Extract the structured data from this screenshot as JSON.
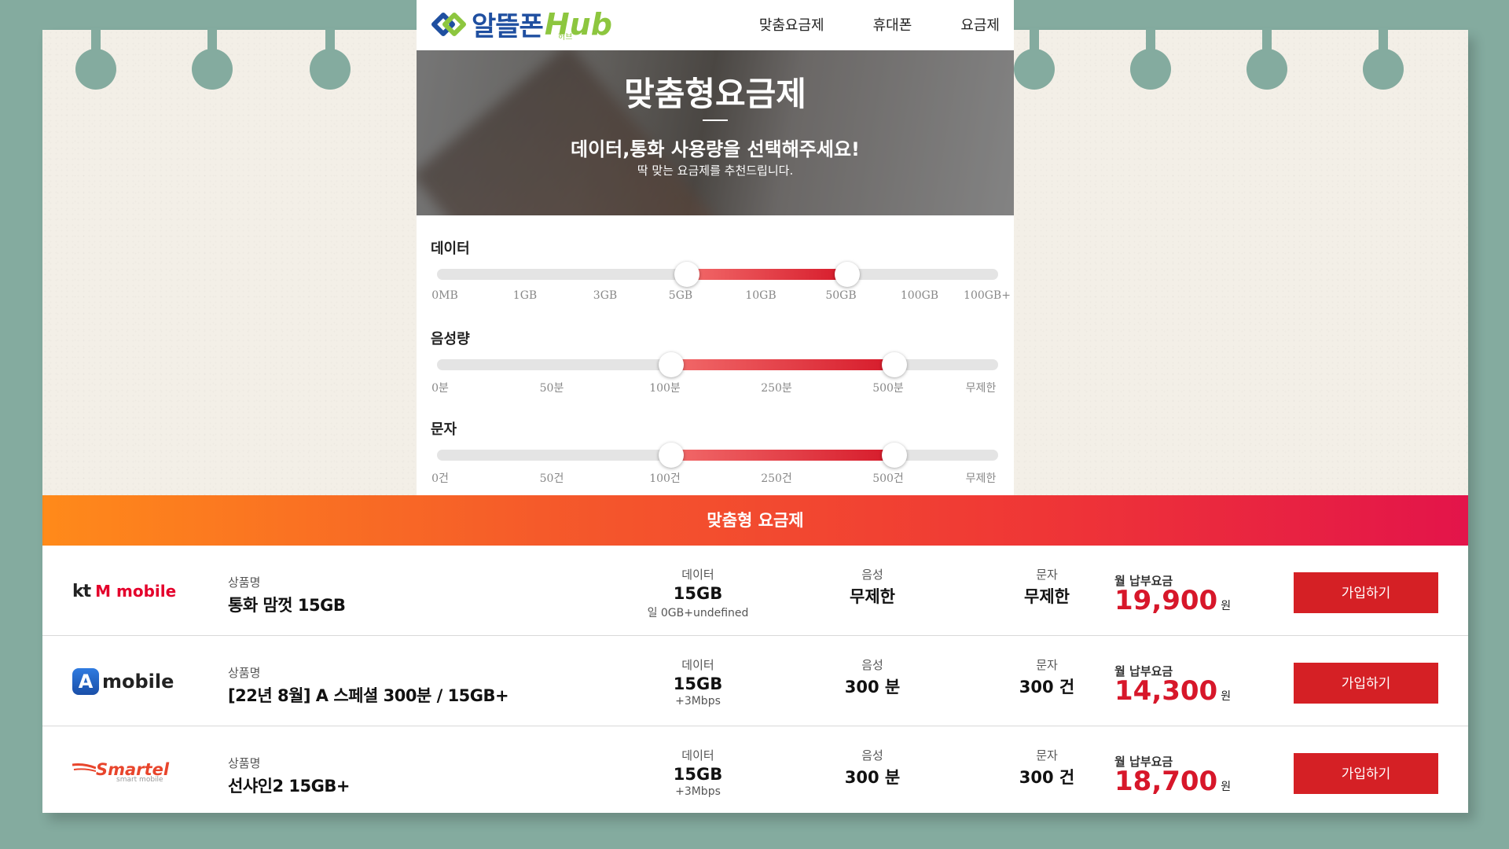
{
  "header": {
    "logo_text": "알뜰폰",
    "logo_hub": "Hub",
    "logo_sub": "허브",
    "nav": [
      "맞춤요금제",
      "휴대폰",
      "요금제"
    ]
  },
  "hero": {
    "title": "맞춤형요금제",
    "subtitle": "데이터,통화 사용량을 선택해주세요!",
    "subtitle2": "딱 맞는 요금제를 추천드립니다."
  },
  "sliders": [
    {
      "label": "데이터",
      "ticks": [
        "0MB",
        "1GB",
        "3GB",
        "5GB",
        "10GB",
        "50GB",
        "100GB",
        "100GB+"
      ],
      "range_from": "5GB",
      "range_to": "50GB"
    },
    {
      "label": "음성량",
      "ticks": [
        "0분",
        "50분",
        "100분",
        "250분",
        "500분",
        "무제한"
      ],
      "range_from": "100분",
      "range_to": "500분"
    },
    {
      "label": "문자",
      "ticks": [
        "0건",
        "50건",
        "100건",
        "250건",
        "500건",
        "무제한"
      ],
      "range_from": "100건",
      "range_to": "500건"
    }
  ],
  "results": {
    "title": "맞춤형 요금제",
    "labels": {
      "product": "상품명",
      "data": "데이터",
      "voice": "음성",
      "sms": "문자",
      "price": "월 납부요금",
      "won": "원",
      "join": "가입하기"
    },
    "plans": [
      {
        "carrier": "kt M mobile",
        "carrier_kt": "kt",
        "carrier_rest": "M mobile",
        "name": "통화 맘껏 15GB",
        "data": "15GB",
        "data_extra": "일 0GB+undefined",
        "voice": "무제한",
        "sms": "무제한",
        "price": "19,900"
      },
      {
        "carrier": "A mobile",
        "carrier_mark": "A",
        "carrier_rest": "mobile",
        "name": "[22년 8월] A 스페셜 300분 / 15GB+",
        "data": "15GB",
        "data_extra": "+3Mbps",
        "voice": "300 분",
        "sms": "300 건",
        "price": "14,300"
      },
      {
        "carrier": "Smartel",
        "carrier_name": "Smartel",
        "carrier_sub": "smart mobile",
        "name": "선샤인2 15GB+",
        "data": "15GB",
        "data_extra": "+3Mbps",
        "voice": "300 분",
        "sms": "300 건",
        "price": "18,700"
      }
    ]
  },
  "colors": {
    "background": "#84ab9f",
    "paper": "#f3efe7",
    "accent": "#d61a2a",
    "button": "#d52025",
    "logo_blue": "#1f4fa0",
    "logo_green": "#8dc63f"
  }
}
